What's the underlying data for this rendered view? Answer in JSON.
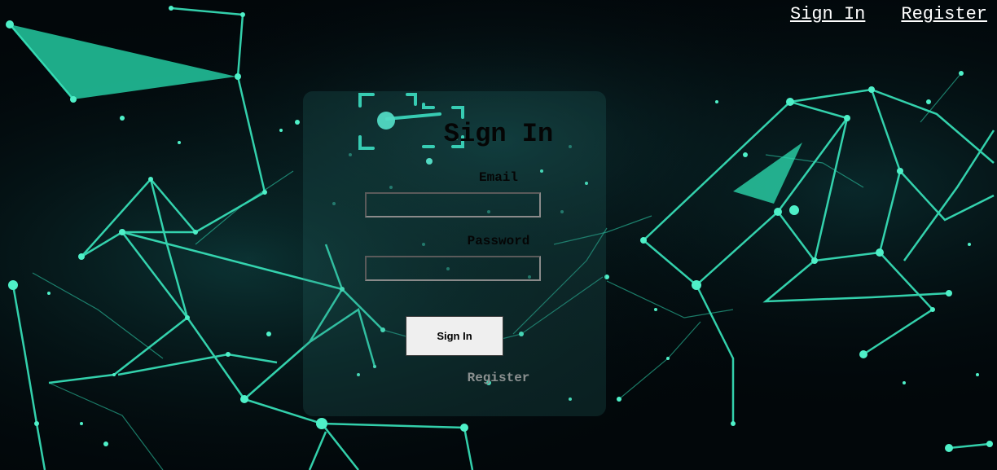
{
  "nav": {
    "sign_in": "Sign In",
    "register": "Register"
  },
  "form": {
    "title": "Sign In",
    "email_label": "Email",
    "email_value": "",
    "password_label": "Password",
    "password_value": "",
    "submit_label": "Sign In",
    "register_link": "Register"
  },
  "colors": {
    "accent": "#2fe0b8",
    "background": "#02070a",
    "card": "#1a4d4a"
  },
  "icons": {
    "background": "network-plexus-graphic",
    "card_decoration": "focus-frame-icon"
  }
}
